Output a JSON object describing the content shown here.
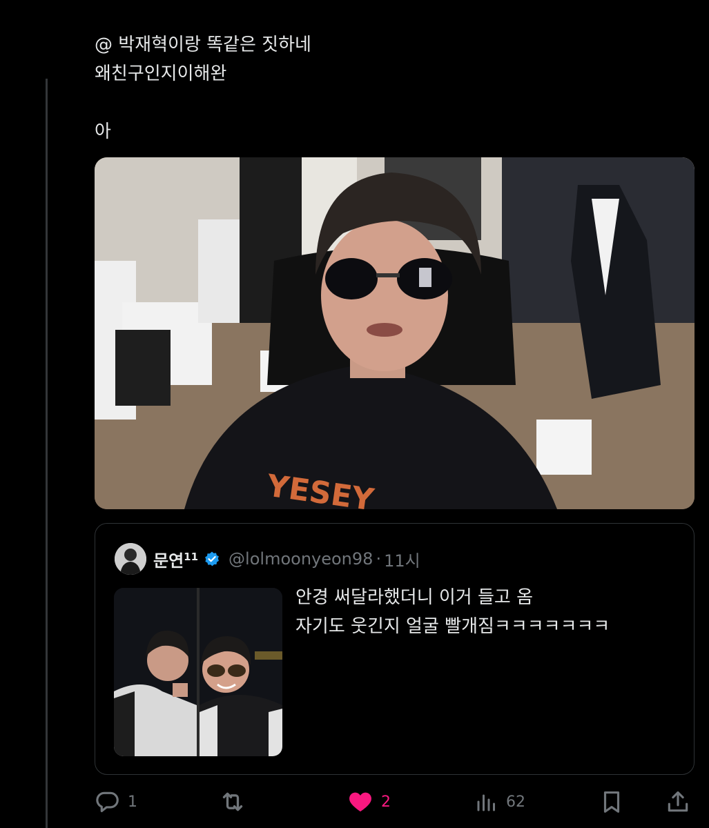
{
  "tweet": {
    "text_lines": [
      "@ 박재혁이랑 똑같은 짓하네",
      "왜친구인지이해완"
    ],
    "text_after_gap": "아"
  },
  "main_media": {
    "shirt_text": "YESEY"
  },
  "quote": {
    "display_name": "문연",
    "name_superscript": "11",
    "handle": "@lolmoonyeon98",
    "dot": "·",
    "time": "11시",
    "text_lines": [
      "안경 써달라했더니 이거 들고 옴",
      "자기도 웃긴지 얼굴 빨개짐ㅋㅋㅋㅋㅋㅋㅋ"
    ]
  },
  "actions": {
    "reply_count": "1",
    "repost_count": "",
    "like_count": "2",
    "views_count": "62"
  },
  "colors": {
    "background": "#000000",
    "text": "#e7e9ea",
    "muted": "#71767b",
    "like": "#f91880",
    "verified": "#1d9bf0",
    "border": "#2f3336"
  },
  "icons": {
    "reply": "reply-icon",
    "repost": "repost-icon",
    "like": "heart-icon",
    "views": "views-icon",
    "bookmark": "bookmark-icon",
    "share": "share-icon",
    "verified": "verified-badge-icon"
  }
}
